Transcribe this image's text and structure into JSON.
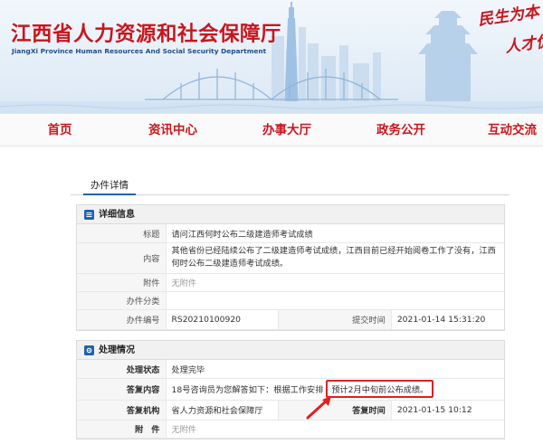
{
  "header": {
    "title": "江西省人力资源和社会保障厅",
    "subtitle": "JiangXi Province Human Resources And Social Security Department",
    "motto_1": "民生为本",
    "motto_2": "人才优先"
  },
  "nav": {
    "items": [
      {
        "label": "首页"
      },
      {
        "label": "资讯中心"
      },
      {
        "label": "办事大厅"
      },
      {
        "label": "政务公开"
      },
      {
        "label": "互动交流"
      }
    ]
  },
  "tabs": {
    "active_label": "办件详情"
  },
  "detail": {
    "section_title": "详细信息",
    "rows": {
      "title_key": "标题",
      "title_value": "请问江西何时公布二级建造师考试成绩",
      "content_key": "内容",
      "content_value": "其他省份已经陆续公布了二级建造师考试成绩，江西目前已经开始阅卷工作了没有，江西何时公布二级建造师考试成绩。",
      "attachment_key": "附件",
      "attachment_value": "无附件",
      "category_key": "办件分类",
      "category_value": "",
      "number_key": "办件编号",
      "number_value": "RS20210100920",
      "submit_time_key": "提交时间",
      "submit_time_value": "2021-01-14 15:31:20"
    }
  },
  "processing": {
    "section_title": "处理情况",
    "rows": {
      "status_key": "处理状态",
      "status_value": "处理完毕",
      "reply_key": "答复内容",
      "reply_value_prefix": "18号咨询员为您解答如下：根据工作安排",
      "reply_value_highlight": "预计2月中旬前公布成绩。",
      "org_key": "答复机构",
      "org_value": "省人力资源和社会保障厅",
      "reply_time_key": "答复时间",
      "reply_time_value": "2021-01-15 10:12",
      "attachment_key": "附　件",
      "attachment_value": "无附件"
    }
  },
  "colors": {
    "brand_red": "#c8161d",
    "accent_blue": "#1f62b3",
    "highlight_red": "#e02020"
  }
}
